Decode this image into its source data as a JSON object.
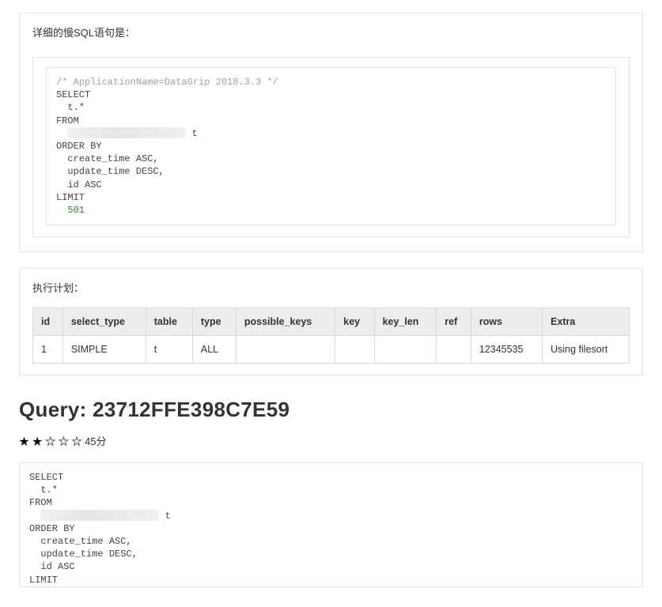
{
  "top_section": {
    "title": "详细的慢SQL语句是：",
    "sql_comment": "/* ApplicationName=DataGrip 2018.3.3 */",
    "sql": {
      "select": "SELECT",
      "select_cols": "  t.*",
      "from": "FROM",
      "from_alias": " t",
      "order_by": "ORDER BY",
      "order_items": [
        "  create_time ASC,",
        "  update_time DESC,",
        "  id ASC"
      ],
      "limit_kw": "LIMIT",
      "limit_val": "  501"
    }
  },
  "exec_plan": {
    "title": "执行计划：",
    "headers": [
      "id",
      "select_type",
      "table",
      "type",
      "possible_keys",
      "key",
      "key_len",
      "ref",
      "rows",
      "Extra"
    ],
    "row": {
      "id": "1",
      "select_type": "SIMPLE",
      "table": "t",
      "type": "ALL",
      "possible_keys": "",
      "key": "",
      "key_len": "",
      "ref": "",
      "rows": "12345535",
      "Extra": "Using filesort"
    }
  },
  "query_section": {
    "heading": "Query: 23712FFE398C7E59",
    "stars": {
      "filled": "★ ★",
      "empty": "☆ ☆ ☆",
      "score": " 45分"
    },
    "sql": {
      "select": "SELECT",
      "select_cols": "  t.*",
      "from": "FROM",
      "from_alias": " t",
      "order_by": "ORDER BY",
      "order_items": [
        "  create_time ASC,",
        "  update_time DESC,",
        "  id ASC"
      ],
      "limit_kw": "LIMIT"
    }
  }
}
